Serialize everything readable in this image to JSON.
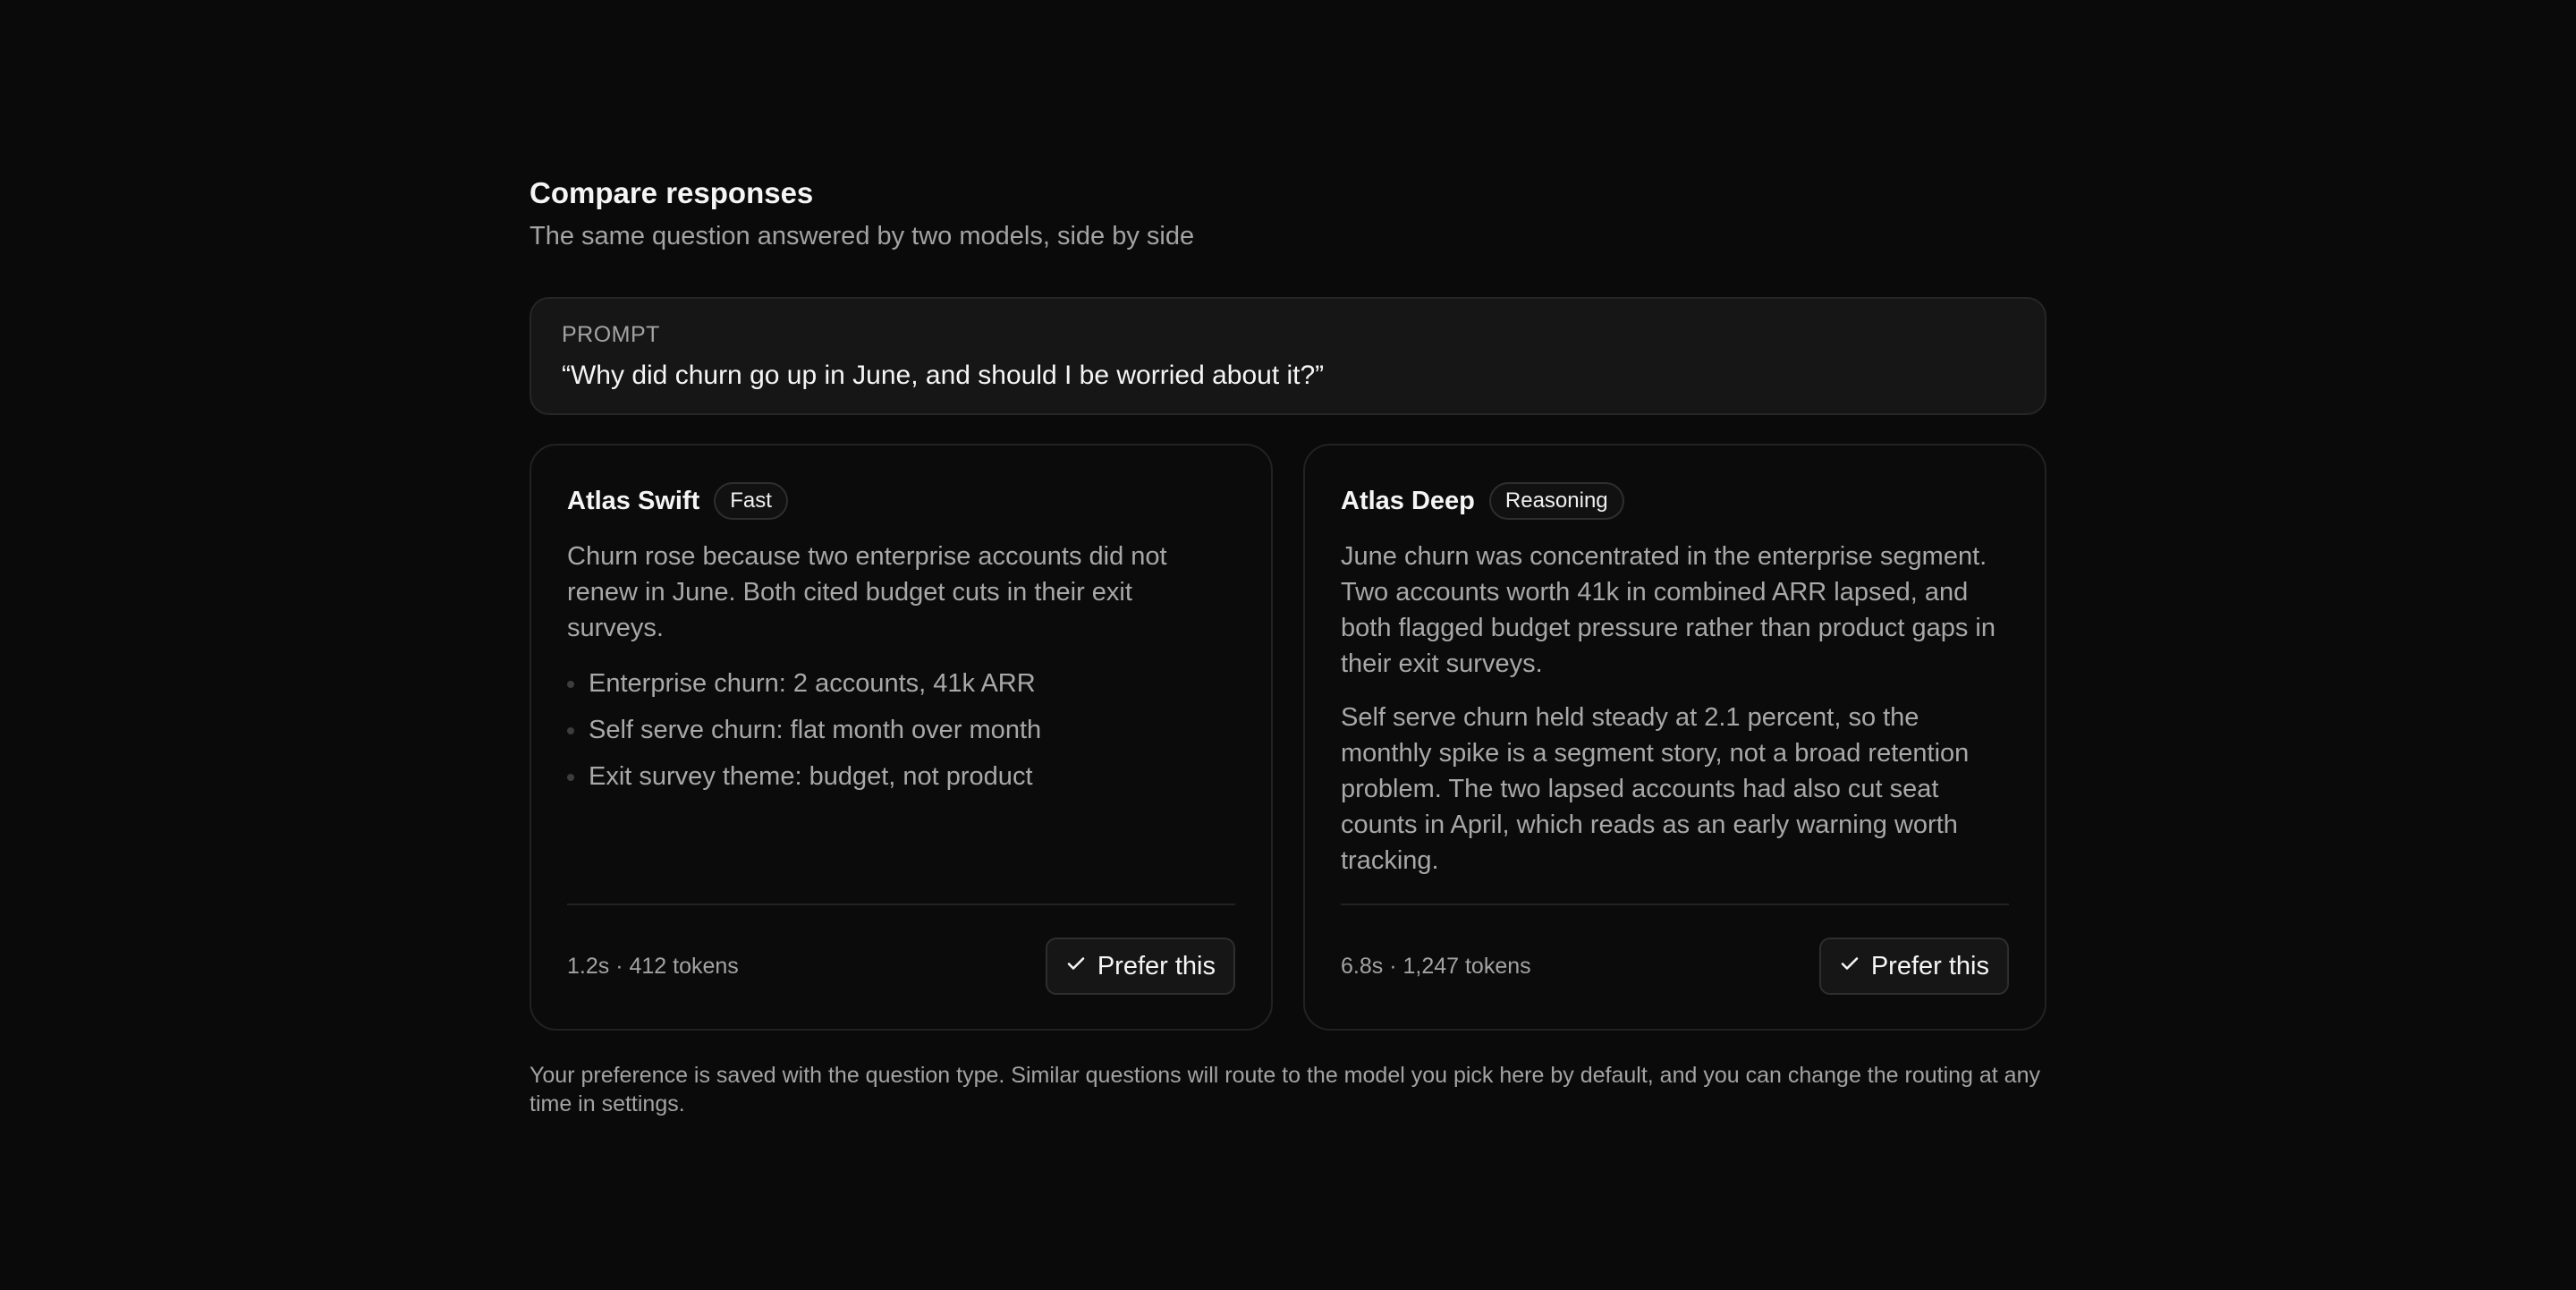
{
  "header": {
    "title": "Compare responses",
    "subtitle": "The same question answered by two models, side by side"
  },
  "prompt": {
    "label": "PROMPT",
    "text": "“Why did churn go up in June, and should I be worried about it?”"
  },
  "cards": [
    {
      "model": "Atlas Swift",
      "badge": "Fast",
      "paragraphs": [
        "Churn rose because two enterprise accounts did not renew in June. Both cited budget cuts in their exit surveys."
      ],
      "bullets": [
        "Enterprise churn: 2 accounts, 41k ARR",
        "Self serve churn: flat month over month",
        "Exit survey theme: budget, not product"
      ],
      "meta": "1.2s · 412 tokens",
      "prefer_label": "Prefer this"
    },
    {
      "model": "Atlas Deep",
      "badge": "Reasoning",
      "paragraphs": [
        "June churn was concentrated in the enterprise segment. Two accounts worth 41k in combined ARR lapsed, and both flagged budget pressure rather than product gaps in their exit surveys.",
        "Self serve churn held steady at 2.1 percent, so the monthly spike is a segment story, not a broad retention problem. The two lapsed accounts had also cut seat counts in April, which reads as an early warning worth tracking."
      ],
      "meta": "6.8s · 1,247 tokens",
      "prefer_label": "Prefer this"
    }
  ],
  "footnote": "Your preference is saved with the question type. Similar questions will route to the model you pick here by default, and you can change the routing at any time in settings.",
  "icons": {
    "prefer": "check-icon"
  }
}
